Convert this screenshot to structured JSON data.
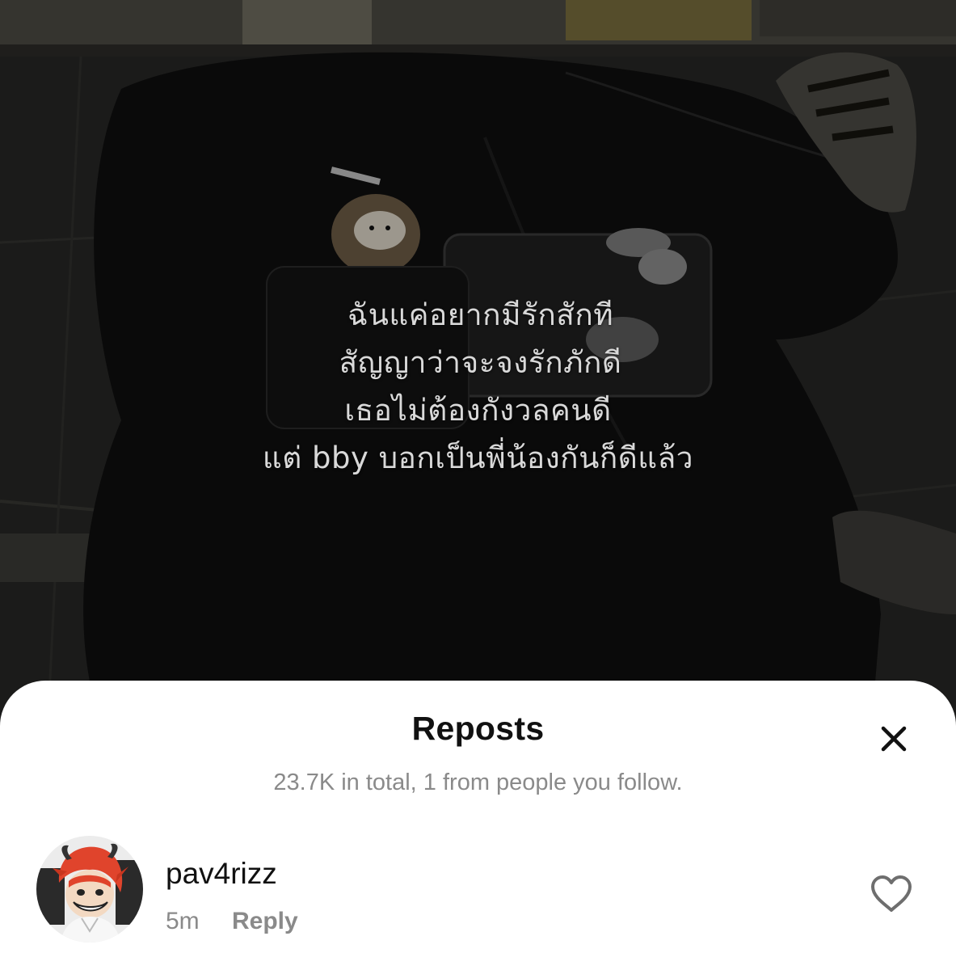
{
  "video": {
    "lyrics": [
      "ฉันแค่อยากมีรักสักที",
      "สัญญาว่าจะจงรักภักดี",
      "เธอไม่ต้องกังวลคนดี",
      "แต่ bby บอกเป็นพี่น้องกันก็ดีแล้ว"
    ]
  },
  "sheet": {
    "title": "Reposts",
    "subtitle": "23.7K in total, 1 from people you follow.",
    "close_icon": "close-icon"
  },
  "reposts": [
    {
      "username": "pav4rizz",
      "time": "5m",
      "reply_label": "Reply",
      "avatar_icon": "anime-avatar",
      "like_icon": "heart-outline-icon"
    }
  ],
  "colors": {
    "sheet_bg": "#ffffff",
    "title": "#111111",
    "muted": "#8a8a8a",
    "lyrics": "#d9d9d9"
  }
}
